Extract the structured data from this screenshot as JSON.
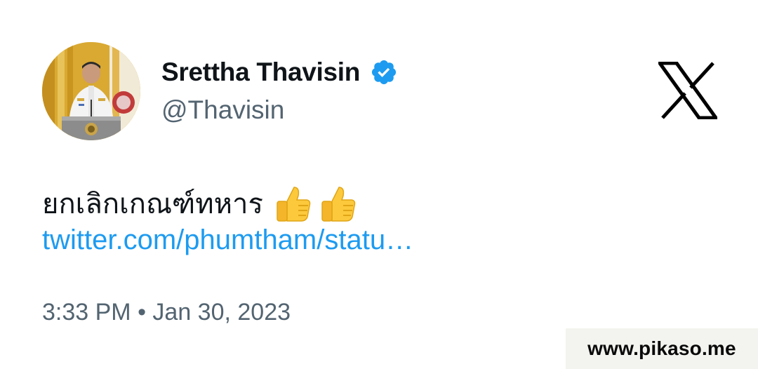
{
  "tweet": {
    "author": {
      "display_name": "Srettha Thavisin",
      "handle": "@Thavisin",
      "verified": true,
      "verified_color": "#1d9bf0"
    },
    "text": "ยกเลิกเกณฑ์ทหาร",
    "emoji": [
      "thumbs-up",
      "thumbs-up"
    ],
    "link": "twitter.com/phumtham/statu…",
    "timestamp": "3:33 PM • Jan 30, 2023",
    "platform_icon": "x-logo"
  },
  "watermark": {
    "text": "www.pikaso.me"
  },
  "colors": {
    "text_primary": "#0f1419",
    "text_secondary": "#536471",
    "link": "#1d9bf0",
    "background": "#ffffff",
    "watermark_bg": "#f3f3ef"
  }
}
